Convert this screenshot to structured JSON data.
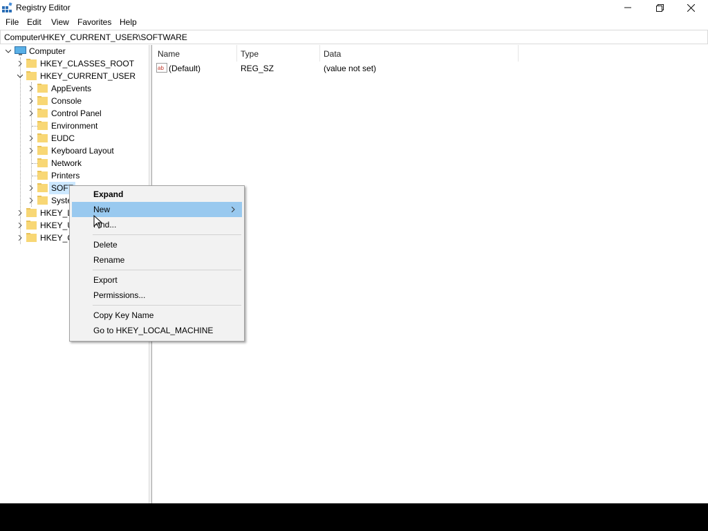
{
  "window": {
    "title": "Registry Editor"
  },
  "menu": [
    "File",
    "Edit",
    "View",
    "Favorites",
    "Help"
  ],
  "address": "Computer\\HKEY_CURRENT_USER\\SOFTWARE",
  "tree": {
    "root": "Computer",
    "hives": [
      "HKEY_CLASSES_ROOT",
      "HKEY_CURRENT_USER",
      "HKEY_L",
      "HKEY_U",
      "HKEY_C"
    ],
    "hkcu_children": [
      "AppEvents",
      "Console",
      "Control Panel",
      "Environment",
      "EUDC",
      "Keyboard Layout",
      "Network",
      "Printers",
      "SOFT",
      "Syste"
    ]
  },
  "list": {
    "columns": [
      "Name",
      "Type",
      "Data"
    ],
    "rows": [
      {
        "name": "(Default)",
        "type": "REG_SZ",
        "data": "(value not set)"
      }
    ]
  },
  "context_menu": {
    "items": [
      "Expand",
      "New",
      "Find...",
      "Delete",
      "Rename",
      "Export",
      "Permissions...",
      "Copy Key Name",
      "Go to HKEY_LOCAL_MACHINE"
    ],
    "highlighted": "New"
  },
  "colors": {
    "menu_highlight": "#99c9ef",
    "folder": "#f8d775",
    "selection": "#cce8ff"
  }
}
